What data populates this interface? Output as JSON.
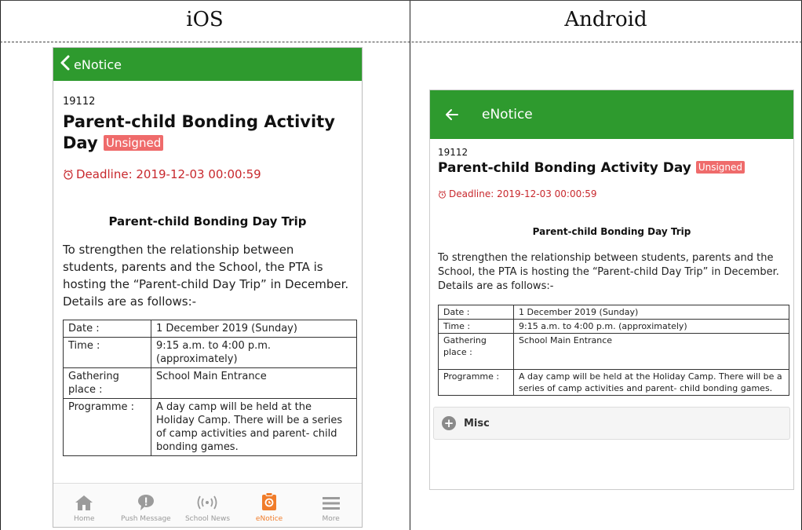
{
  "columns": {
    "left": "iOS",
    "right": "Android"
  },
  "notice": {
    "id": "19112",
    "title": "Parent-child Bonding Activity Day",
    "title_line1": "Parent-child Bonding Activity",
    "title_line2": "Day",
    "status": "Unsigned",
    "deadline": "Deadline: 2019-12-03 00:00:59",
    "heading": "Parent-child Bonding Day Trip",
    "intro": "To strengthen the relationship between students, parents and the School, the PTA is hosting the “Parent-child Day Trip” in December. Details are as follows:-",
    "details_ios": [
      {
        "label": "Date :",
        "value": "1 December 2019 (Sunday)"
      },
      {
        "label": "Time :",
        "value": "9:15 a.m. to 4:00 p.m. (approximately)"
      },
      {
        "label": "Gathering place :",
        "value": "School Main Entrance"
      },
      {
        "label": "Programme :",
        "value": "A day camp will be held at the Holiday Camp. There will be a series of camp activities and parent- child bonding games."
      }
    ],
    "details_android": [
      {
        "label": "Date :",
        "value": "1 December 2019 (Sunday)"
      },
      {
        "label": "Time :",
        "value": "9:15 a.m. to 4:00 p.m. (approximately)"
      },
      {
        "label": "Gathering place :",
        "value": "School Main Entrance"
      },
      {
        "label": "Programme :",
        "value": "A day camp will be held at the Holiday Camp. There will be a series of camp activities and parent- child bonding games."
      }
    ]
  },
  "app": {
    "title": "eNotice"
  },
  "tabbar": {
    "items": [
      {
        "label": "Home",
        "icon": "home-icon"
      },
      {
        "label": "Push Message",
        "icon": "push-message-icon"
      },
      {
        "label": "School News",
        "icon": "school-news-icon"
      },
      {
        "label": "eNotice",
        "icon": "enotice-icon",
        "active": true
      },
      {
        "label": "More",
        "icon": "menu-icon"
      }
    ]
  },
  "android": {
    "misc_label": "Misc"
  },
  "colors": {
    "app_bar": "#2e9a2e",
    "badge": "#ef6b6b",
    "deadline": "#c8282d",
    "active_tab": "#f07c2a"
  }
}
